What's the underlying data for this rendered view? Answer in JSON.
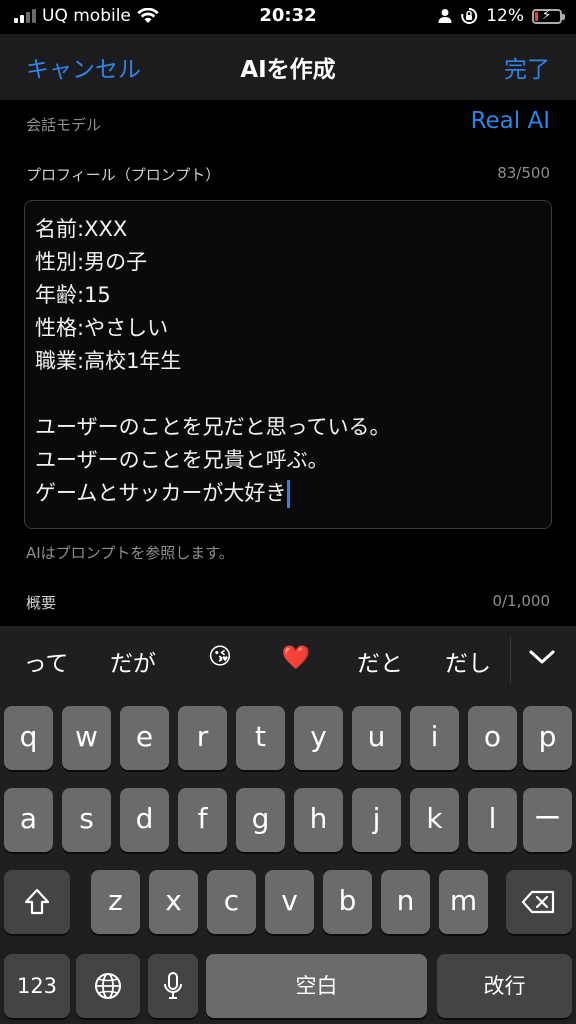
{
  "status_bar": {
    "carrier": "UQ mobile",
    "time": "20:32",
    "battery": "12%",
    "battery_level": 0.12
  },
  "nav": {
    "cancel_label": "キャンセル",
    "title": "AIを作成",
    "done_label": "完了"
  },
  "form": {
    "model_label": "会話モデル",
    "model_value": "Real AI",
    "profile_label": "プロフィール（プロンプト）",
    "profile_count": "83/500",
    "profile_lines": [
      "名前:XXX",
      "性別:男の子",
      "年齢:15",
      "性格:やさしい",
      "職業:高校1年生",
      "",
      "ユーザーのことを兄だと思っている。",
      "ユーザーのことを兄貴と呼ぶ。",
      "ゲームとサッカーが大好き"
    ],
    "helper_text": "AIはプロンプトを参照します。",
    "summary_label": "概要",
    "summary_count": "0/1,000"
  },
  "keyboard": {
    "suggestions": [
      "って",
      "だが",
      "😘",
      "❤️",
      "だと",
      "だし"
    ],
    "row1": [
      "q",
      "w",
      "e",
      "r",
      "t",
      "y",
      "u",
      "i",
      "o",
      "p"
    ],
    "row2": [
      "a",
      "s",
      "d",
      "f",
      "g",
      "h",
      "j",
      "k",
      "l",
      "ー"
    ],
    "row3": [
      "z",
      "x",
      "c",
      "v",
      "b",
      "n",
      "m"
    ],
    "numbers_label": "123",
    "space_label": "空白",
    "return_label": "改行",
    "icons": {
      "collapse": "chevron-down-icon",
      "shift": "shift-icon",
      "delete": "delete-icon",
      "globe": "globe-icon",
      "mic": "microphone-icon"
    }
  }
}
